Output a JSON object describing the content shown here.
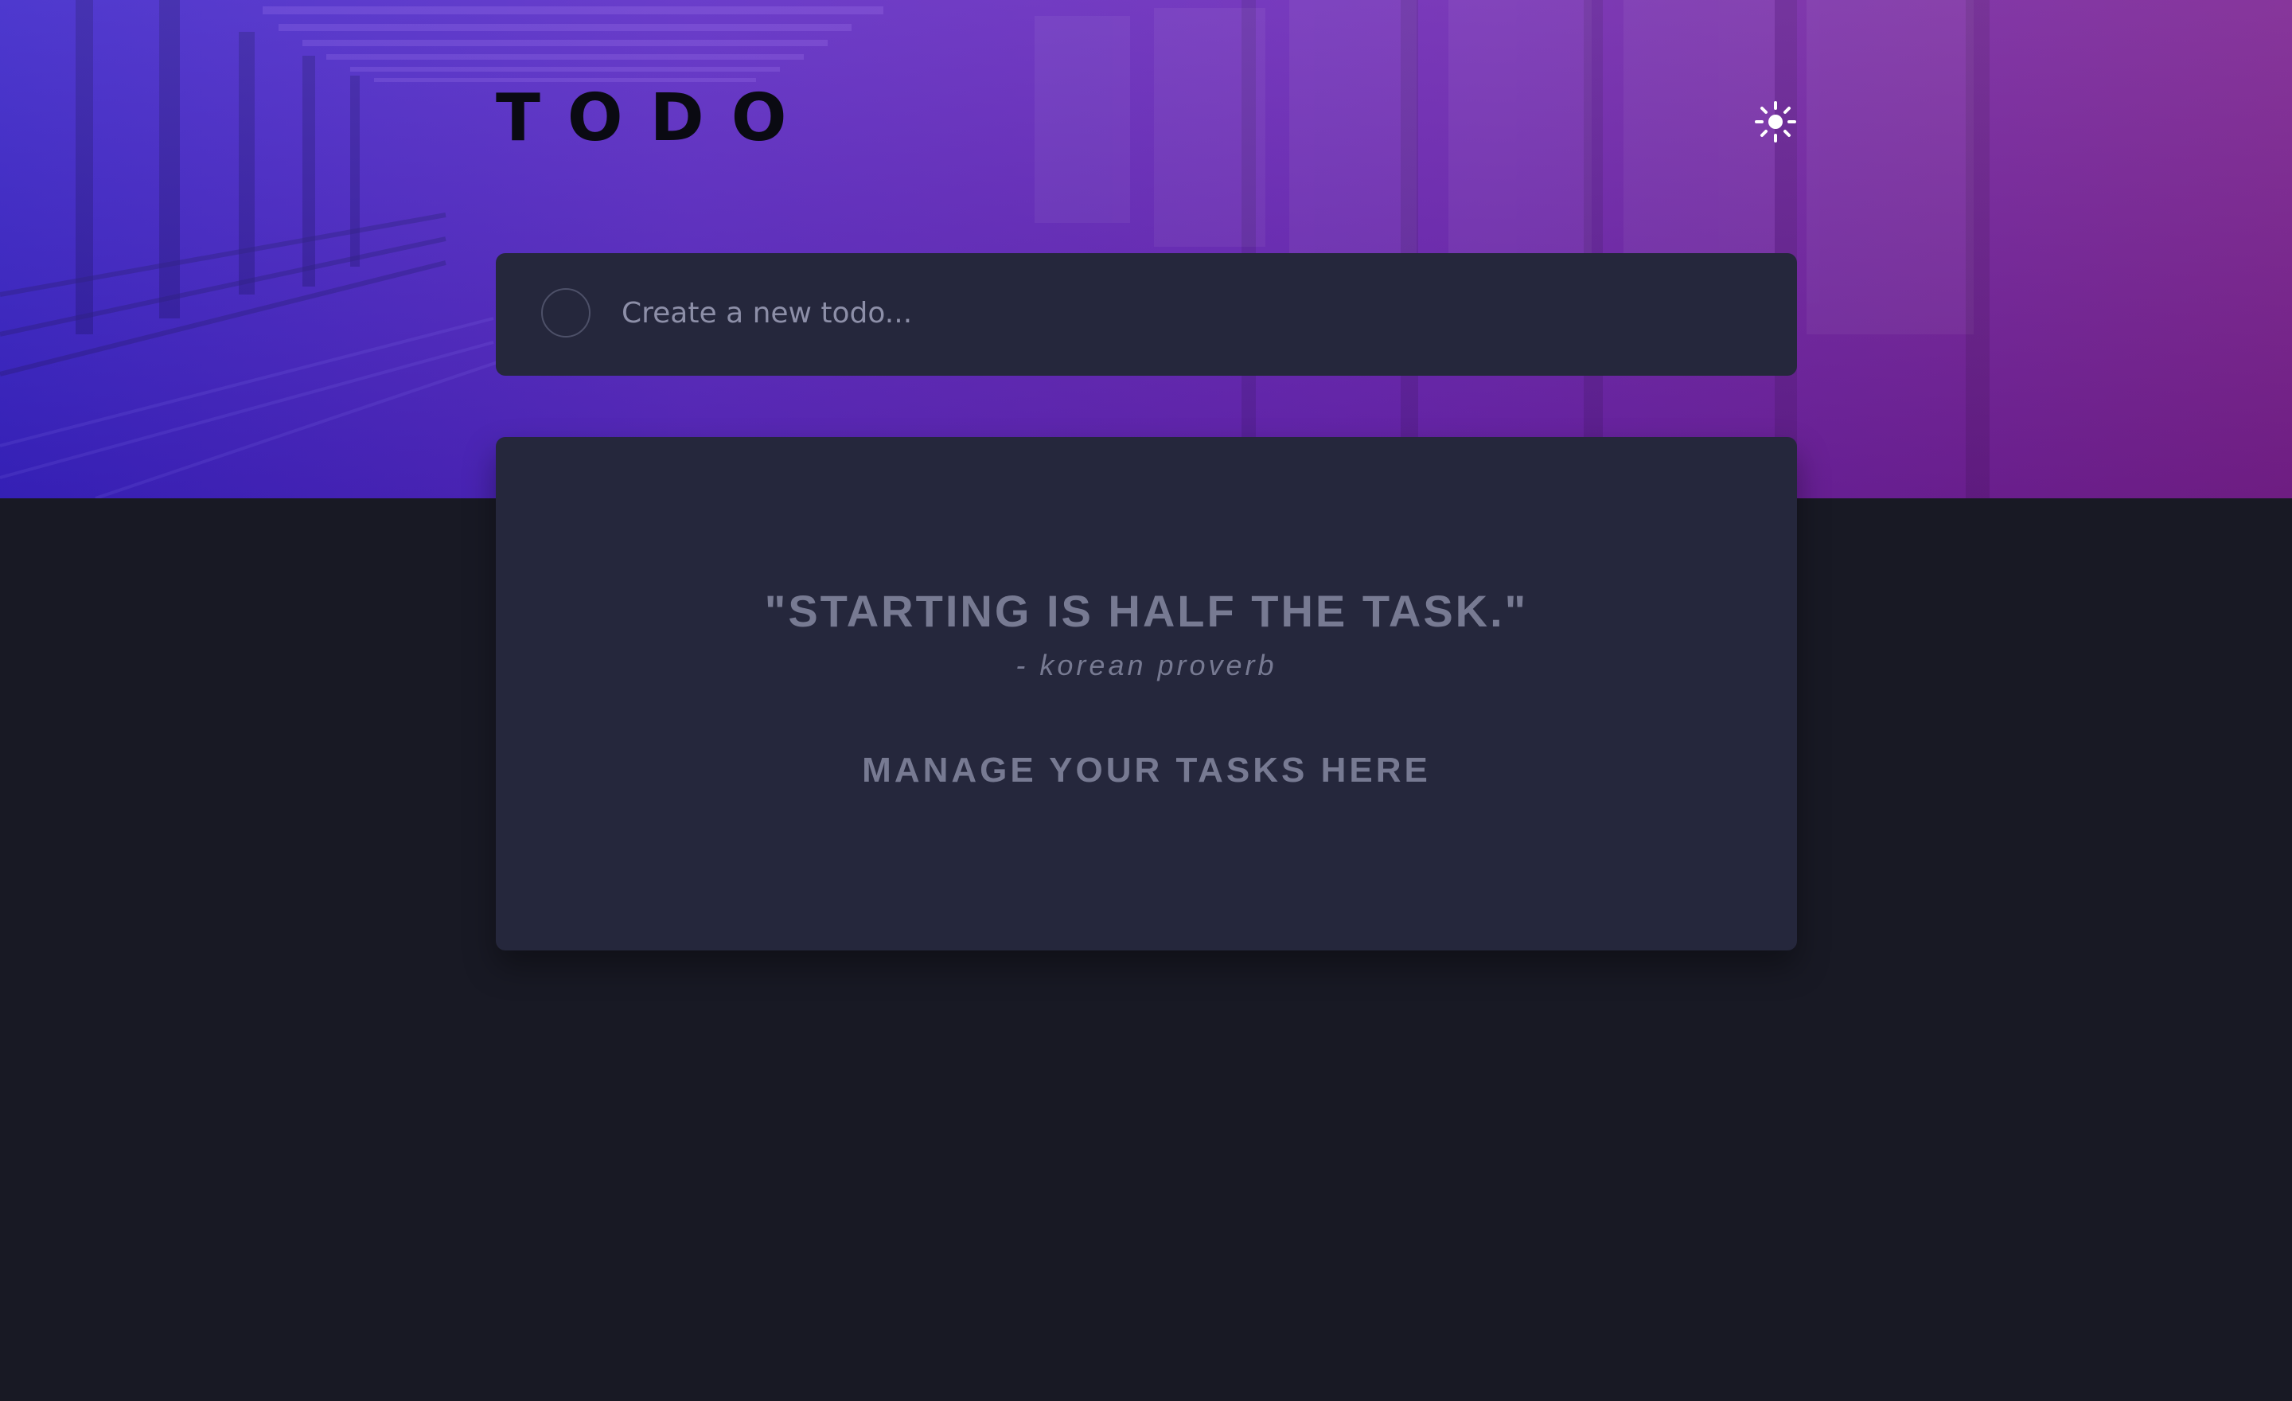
{
  "header": {
    "title": "TODO",
    "theme_toggle_icon": "sun-icon"
  },
  "new_todo": {
    "placeholder": "Create a new todo..."
  },
  "empty_state": {
    "quote": "\"STARTING IS HALF THE TASK.\"",
    "author": "- korean proverb",
    "message": "MANAGE YOUR TASKS HERE"
  },
  "colors": {
    "page_background": "#181924",
    "card_background": "#25273c",
    "muted_text": "#777a92",
    "hero_gradient_start": "#3a23c9",
    "hero_gradient_end": "#7a2090"
  }
}
